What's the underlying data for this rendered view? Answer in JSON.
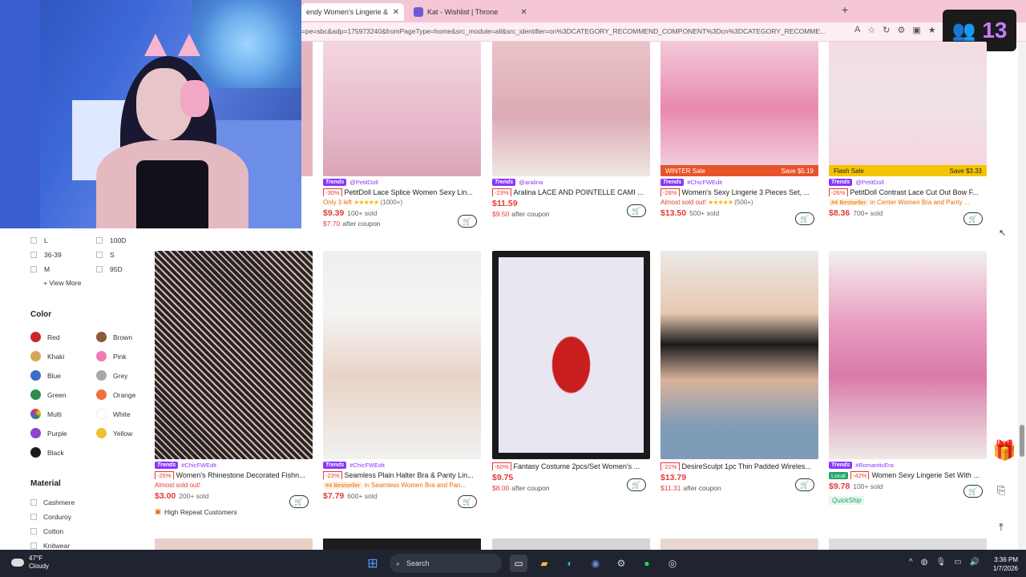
{
  "browser": {
    "tabs": [
      {
        "label": "endy Women's Lingerie & Loung",
        "active": true
      },
      {
        "label": "Kat - Wishlist | Throne",
        "active": false
      }
    ],
    "new_tab": "+",
    "url": "=pe=sbc&adp=175973240&fromPageType=home&src_module=all&src_identifier=on%3DCATEGORY_RECOMMEND_COMPONENT%3Dcn%3DCATEGORY_RECOMME..."
  },
  "viewer_badge": {
    "count": "13"
  },
  "products": [
    {
      "trends": "Trends",
      "brand": "@PetitDoll",
      "discount": "-30%",
      "title": "PetitDoll Lace Splice Women Sexy Lin...",
      "note": "Only 3 left",
      "rating_count": "(1000+)",
      "price": "$9.39",
      "sold": "100+ sold",
      "coupon_price": "$7.70",
      "coupon_label": "after coupon"
    },
    {
      "trends": "Trends",
      "brand": "@aralina",
      "discount": "-23%",
      "title": "Aralina LACE AND POINTELLE CAMI ...",
      "price": "$11.59",
      "coupon_price": "$9.50",
      "coupon_label": "after coupon"
    },
    {
      "trends": "Trends",
      "brand": "#ChicFWEdit",
      "discount": "-28%",
      "title": "Women's Sexy Lingerie 3 Pieces Set, ...",
      "note": "Almost sold out!",
      "rating_count": "(500+)",
      "price": "$13.50",
      "sold": "500+ sold",
      "banner_left": "WINTER Sale",
      "banner_right": "Save $5.19"
    },
    {
      "trends": "Trends",
      "brand": "@PetitDoll",
      "discount": "-26%",
      "title": "PetitDoll Contrast Lace Cut Out Bow F...",
      "bestseller": "#4 Bestseller",
      "bestseller_in": "in Center Women Bra and Panty ...",
      "price": "$8.36",
      "sold": "700+ sold",
      "banner_left": "Flash Sale",
      "banner_right": "Save $3.33"
    },
    {
      "trends": "Trends",
      "brand": "#ChicFWEdit",
      "discount": "-25%",
      "title": "Women's Rhinestone Decorated Fishn...",
      "note": "Almost sold out!",
      "price": "$3.00",
      "sold": "200+ sold",
      "extra": "High Repeat Customers"
    },
    {
      "trends": "Trends",
      "brand": "#ChicFWEdit",
      "discount": "-23%",
      "title": "Seamless Plain Halter Bra & Panty Lin...",
      "bestseller": "#4 Bestseller",
      "bestseller_in": "in Seamless Women Bra and Pan...",
      "price": "$7.79",
      "sold": "600+ sold"
    },
    {
      "discount": "-60%",
      "title": "Fantasy Costume 2pcs/Set Women's ...",
      "price": "$9.75",
      "coupon_price": "$8.00",
      "coupon_label": "after coupon"
    },
    {
      "discount": "-22%",
      "title": "DesireSculpt 1pc Thin Padded Wireles...",
      "price": "$13.79",
      "coupon_price": "$11.31",
      "coupon_label": "after coupon"
    },
    {
      "trends": "Trends",
      "brand": "#RomanticEra",
      "local": "Local",
      "discount": "-42%",
      "title": "Women Sexy Lingerie Set With ...",
      "price": "$9.78",
      "sold": "100+ sold",
      "quickship": "QuickShip"
    }
  ],
  "sidebar": {
    "sizes": [
      "L",
      "100D",
      "36-39",
      "S",
      "M",
      "95D"
    ],
    "view_more": "+ View More",
    "color_title": "Color",
    "colors": [
      {
        "name": "Red",
        "hex": "#c62828"
      },
      {
        "name": "Brown",
        "hex": "#8d5a3b"
      },
      {
        "name": "Khaki",
        "hex": "#d8a55a"
      },
      {
        "name": "Pink",
        "hex": "#f07ab5"
      },
      {
        "name": "Blue",
        "hex": "#3a6fc4"
      },
      {
        "name": "Grey",
        "hex": "#a8a8a8"
      },
      {
        "name": "Green",
        "hex": "#2e8b4a"
      },
      {
        "name": "Orange",
        "hex": "#f0713a"
      },
      {
        "name": "Multi",
        "hex": "multi"
      },
      {
        "name": "White",
        "hex": "#ffffff"
      },
      {
        "name": "Purple",
        "hex": "#8e44c8"
      },
      {
        "name": "Yellow",
        "hex": "#f2c12e"
      },
      {
        "name": "Black",
        "hex": "#1a1a1a"
      }
    ],
    "material_title": "Material",
    "materials": [
      "Cashmere",
      "Corduroy",
      "Cotton",
      "Knitwear"
    ]
  },
  "taskbar": {
    "weather_temp": "47°F",
    "weather_desc": "Cloudy",
    "search_label": "Search",
    "time": "3:36 PM",
    "date": "1/7/2026"
  }
}
